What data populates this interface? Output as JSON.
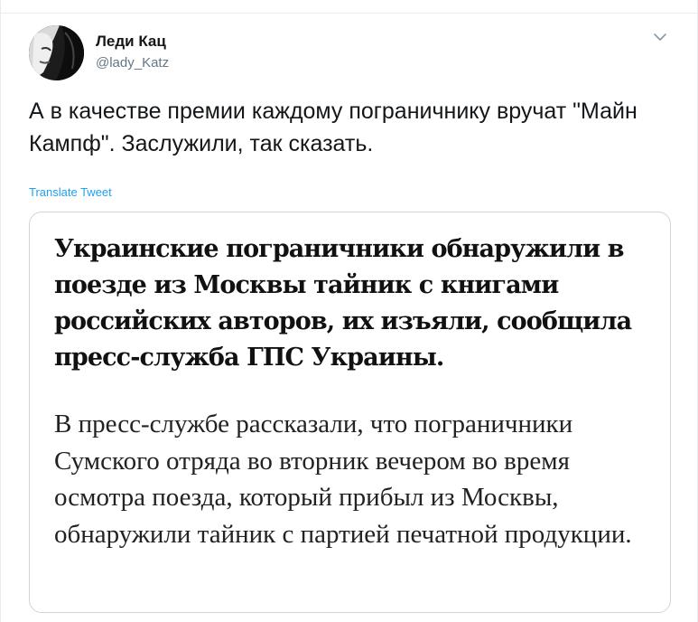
{
  "author": {
    "name": "Леди Кац",
    "handle": "@lady_Katz"
  },
  "tweet": {
    "text": "А в качестве премии каждому пограничнику вручат \"Майн Кампф\". Заслужили, так сказать.",
    "translate_label": "Translate Tweet"
  },
  "card": {
    "headline": "Украинские пограничники обнаружили в поезде из Москвы тайник с книгами российских авторов, их изъяли, сообщила пресс-служба ГПС Украины.",
    "body": "В пресс-службе рассказали, что пограничники Сумского отряда во вторник вечером во время осмотра поезда, который прибыл из Москвы, обнаружили тайник с партией печатной продукции."
  },
  "icons": {
    "menu": "chevron-down-icon",
    "avatar": "avatar-photo"
  },
  "colors": {
    "link": "#1da1f2",
    "secondary_text": "#657786",
    "border": "#ccd6dd"
  }
}
